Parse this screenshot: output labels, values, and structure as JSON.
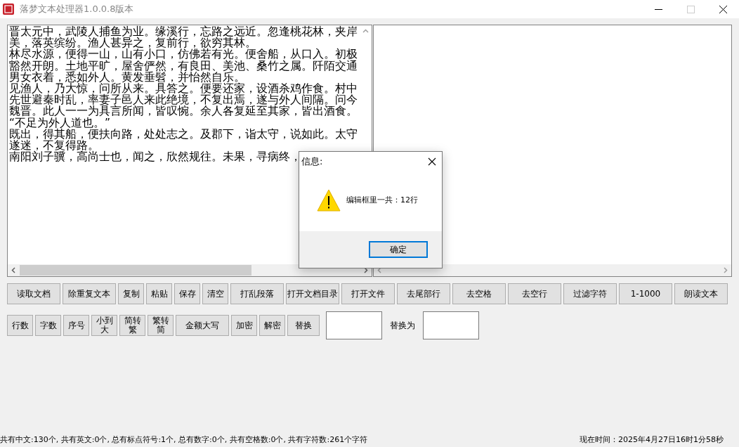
{
  "window": {
    "title": "落梦文本处理器1.0.0.8版本"
  },
  "editor": {
    "lines": [
      "晋太元中，武陵人捕鱼为业。缘溪行，忘路之远近。忽逢桃花林，夹岸",
      "美，落英缤纷。渔人甚异之，复前行，欲穷其林。",
      "林尽水源，便得一山，山有小口，仿佛若有光。便舍船，从口入。初极",
      "豁然开朗。土地平旷，屋舍俨然，有良田、美池、桑竹之属。阡陌交通",
      "男女衣着，悉如外人。黄发垂髫，并怡然自乐。",
      "见渔人，乃大惊，问所从来。具答之。便要还家，设酒杀鸡作食。村中",
      "先世避秦时乱，率妻子邑人来此绝境，不复出焉，遂与外人间隔。问今",
      "魏晋。此人一一为具言所闻，皆叹惋。余人各复延至其家，皆出酒食。",
      "“不足为外人道也。”",
      "既出，得其船，便扶向路，处处志之。及郡下，诣太守，说如此。太守",
      "遂迷，不复得路。",
      "南阳刘子骥，高尚士也，闻之，欣然规往。未果，寻病终，"
    ]
  },
  "toolbar": [
    [
      {
        "label": "读取文档",
        "kind": "wide"
      },
      {
        "label": "除重复文本",
        "kind": "wide"
      },
      {
        "label": "复制",
        "kind": "narrow"
      },
      {
        "label": "粘贴",
        "kind": "narrow"
      },
      {
        "label": "保存",
        "kind": "narrow"
      },
      {
        "label": "清空",
        "kind": "narrow"
      },
      {
        "label": "打乱段落",
        "kind": "wide"
      },
      {
        "label": "打开文档目录",
        "kind": "wide"
      },
      {
        "label": "打开文件",
        "kind": "wide"
      },
      {
        "label": "去尾部行",
        "kind": "wide"
      },
      {
        "label": "去空格",
        "kind": "wide"
      },
      {
        "label": "去空行",
        "kind": "wide"
      },
      {
        "label": "过滤字符",
        "kind": "wide"
      },
      {
        "label": "1-1000",
        "kind": "wide"
      },
      {
        "label": "朗读文本",
        "kind": "wide"
      }
    ],
    [
      {
        "label": "行数",
        "kind": "narrow"
      },
      {
        "label": "字数",
        "kind": "narrow"
      },
      {
        "label": "序号",
        "kind": "narrow"
      },
      {
        "label": "小到大",
        "kind": "narrow"
      },
      {
        "label": "简转繁",
        "kind": "narrow"
      },
      {
        "label": "繁转简",
        "kind": "narrow"
      },
      {
        "label": "金额大写",
        "kind": "wide"
      },
      {
        "label": "加密",
        "kind": "narrow"
      },
      {
        "label": "解密",
        "kind": "narrow"
      },
      {
        "label": "替换",
        "kind": "medium"
      }
    ]
  ],
  "replace": {
    "label": "替换为"
  },
  "dialog": {
    "title": "信息:",
    "message": "编辑框里一共：12行",
    "ok": {
      "label": "确定",
      "focused": true
    }
  },
  "status_bar": {
    "stats": "共有中文:130个, 共有英文:0个, 总有标点符号:1个, 总有数字:0个, 共有空格数:0个, 共有字符数:261个字符",
    "time": "现在时间：2025年4月27日16时1分58秒"
  }
}
